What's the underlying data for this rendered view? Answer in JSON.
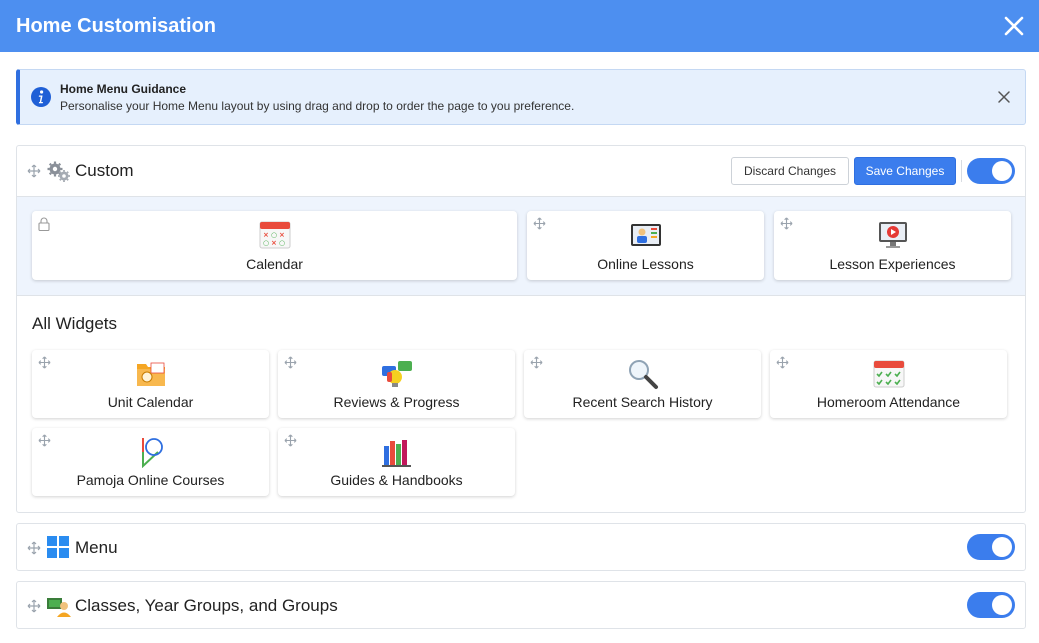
{
  "dialog": {
    "title": "Home Customisation"
  },
  "alert": {
    "title": "Home Menu Guidance",
    "text": "Personalise your Home Menu layout by using drag and drop to order the page to you preference."
  },
  "custom": {
    "title": "Custom",
    "discard_label": "Discard Changes",
    "save_label": "Save Changes",
    "enabled": true,
    "pinned": [
      {
        "label": "Calendar",
        "icon": "calendar-icon",
        "locked": true
      },
      {
        "label": "Online Lessons",
        "icon": "online-lessons-icon",
        "locked": false
      },
      {
        "label": "Lesson Experiences",
        "icon": "lesson-experiences-icon",
        "locked": false
      }
    ],
    "all_widgets_title": "All Widgets",
    "widgets": [
      {
        "label": "Unit Calendar",
        "icon": "unit-calendar-icon"
      },
      {
        "label": "Reviews & Progress",
        "icon": "reviews-progress-icon"
      },
      {
        "label": "Recent Search History",
        "icon": "magnifier-icon"
      },
      {
        "label": "Homeroom Attendance",
        "icon": "attendance-icon"
      },
      {
        "label": "Pamoja Online Courses",
        "icon": "pamoja-icon"
      },
      {
        "label": "Guides & Handbooks",
        "icon": "books-icon"
      }
    ]
  },
  "menu": {
    "title": "Menu",
    "enabled": true
  },
  "classes": {
    "title": "Classes, Year Groups, and Groups",
    "enabled": true
  },
  "colors": {
    "header": "#4d8ff0",
    "accent": "#3b7ded",
    "alert_bg": "#e6f0fd",
    "pinned_bg": "#eef4fd"
  }
}
